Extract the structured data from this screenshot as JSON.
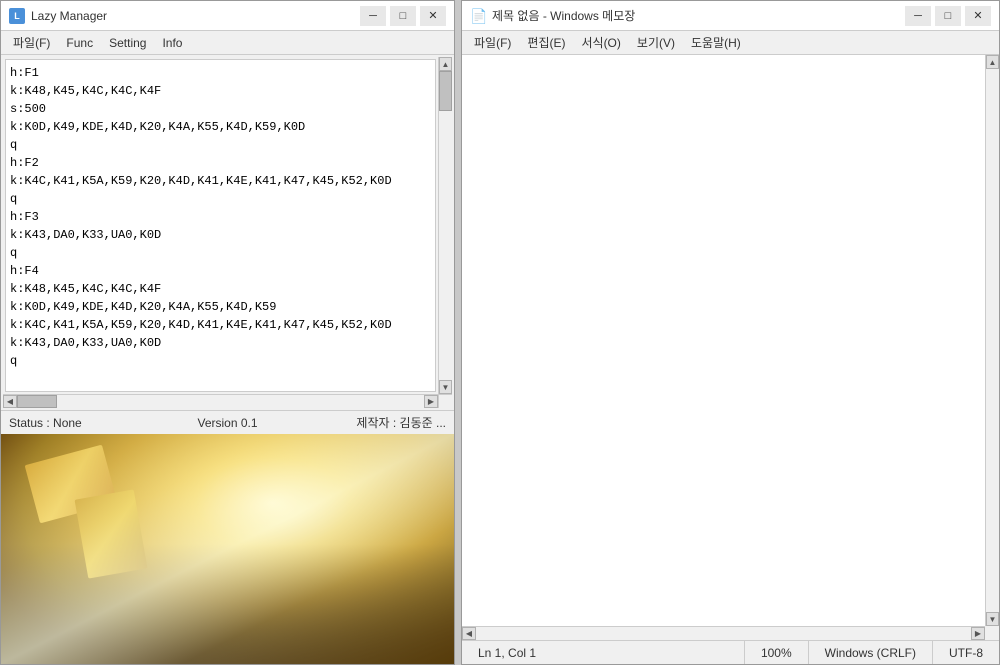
{
  "lazy_window": {
    "title": "Lazy Manager",
    "menu": {
      "items": [
        "파일(F)",
        "Func",
        "Setting",
        "Info"
      ]
    },
    "editor_content": "h:F1\nk:K48,K45,K4C,K4C,K4F\ns:500\nk:K0D,K49,KDE,K4D,K20,K4A,K55,K4D,K59,K0D\nq\nh:F2\nk:K4C,K41,K5A,K59,K20,K4D,K41,K4E,K41,K47,K45,K52,K0D\nq\nh:F3\nk:K43,DA0,K33,UA0,K0D\nq\nh:F4\nk:K48,K45,K4C,K4C,K4F\nk:K0D,K49,KDE,K4D,K20,K4A,K55,K4D,K59\nk:K4C,K41,K5A,K59,K20,K4D,K41,K4E,K41,K47,K45,K52,K0D\nk:K43,DA0,K33,UA0,K0D\nq",
    "status": {
      "status_label": "Status : ",
      "status_value": "None",
      "version": "Version 0.1",
      "author": "제작자 : 김동준 ..."
    }
  },
  "notepad_window": {
    "title": "제목 없음 - Windows 메모장",
    "menu": {
      "items": [
        "파일(F)",
        "편집(E)",
        "서식(O)",
        "보기(V)",
        "도움말(H)"
      ]
    },
    "status": {
      "position": "Ln 1, Col 1",
      "zoom": "100%",
      "line_ending": "Windows (CRLF)",
      "encoding": "UTF-8"
    }
  },
  "window_controls": {
    "minimize": "─",
    "restore": "□",
    "close": "✕"
  }
}
